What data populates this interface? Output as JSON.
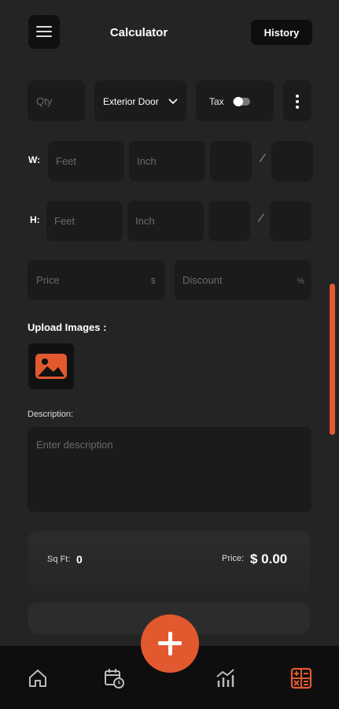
{
  "header": {
    "title": "Calculator",
    "history_label": "History",
    "menu_icon": "hamburger-menu-icon"
  },
  "options_row": {
    "qty_placeholder": "Qty",
    "door_type": "Exterior Door",
    "tax_label": "Tax",
    "tax_enabled": false
  },
  "width_row": {
    "label": "W:",
    "feet_placeholder": "Feet",
    "inch_placeholder": "Inch",
    "separator": "/"
  },
  "height_row": {
    "label": "H:",
    "feet_placeholder": "Feet",
    "inch_placeholder": "Inch",
    "separator": "/"
  },
  "pricing": {
    "price_placeholder": "Price",
    "price_suffix": "$",
    "discount_placeholder": "Discount",
    "discount_suffix": "%"
  },
  "upload": {
    "label": "Upload Images :",
    "icon": "image-icon"
  },
  "description": {
    "label": "Description:",
    "placeholder": "Enter description"
  },
  "summary": {
    "sqft_label": "Sq Ft:",
    "sqft_value": "0",
    "price_label": "Price:",
    "price_value": "$ 0.00"
  },
  "bottom_nav": {
    "items": [
      "home-icon",
      "calendar-clock-icon",
      "analytics-chart-icon",
      "calculator-icon"
    ],
    "active": "calculator-icon",
    "fab_icon": "plus-icon"
  },
  "colors": {
    "accent": "#e2592f",
    "background": "#242424",
    "field": "#1b1b1b"
  }
}
